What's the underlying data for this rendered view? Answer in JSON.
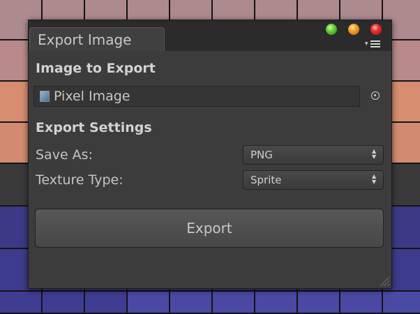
{
  "background": {
    "rows": [
      [
        "#ac8a85",
        "#ac8a85",
        "#d6be75",
        "#ac8a85",
        "#ac8a85",
        "#ac8a85",
        "#ac8a85",
        "#d6be75",
        "#ac8a85",
        "#ac8a85"
      ],
      [
        "#ac8a8e",
        "#ac8a8e",
        "#ac8a8e",
        "#ac8a8e",
        "#ac8a8e",
        "#ac8a8e",
        "#ac8a8e",
        "#ac8a8e",
        "#ac8a8e",
        "#ac8a8e"
      ],
      [
        "#b88a8a",
        "#b88a8a",
        "#b88a8a",
        "#b88a8a",
        "#b88a8a",
        "#b88a8a",
        "#b88a8a",
        "#b88a8a",
        "#b88a8a",
        "#b88a8a"
      ],
      [
        "#d68d70",
        "#d68d70",
        "#d68d70",
        "#d68d70",
        "#d68d70",
        "#d68d70",
        "#d68d70",
        "#d68d70",
        "#d68d70",
        "#d68d70"
      ],
      [
        "#d28a70",
        "#d28a70",
        "#d28a70",
        "#d28a70",
        "#d28a70",
        "#d28a70",
        "#d28a70",
        "#d28a70",
        "#d28a70",
        "#d28a70"
      ],
      [
        "#3a3a3a",
        "#3a3a3a",
        "#3a3a3a",
        "#3a3a3a",
        "#3a3a3a",
        "#3a3a3a",
        "#3a3a3a",
        "#3a3a3a",
        "#3a3a3a",
        "#3a3a3a"
      ],
      [
        "#3c3a86",
        "#3c3a86",
        "#3c3a86",
        "#3c3a86",
        "#3c3a86",
        "#3c3a86",
        "#3c3a86",
        "#3c3a86",
        "#3c3a86",
        "#3c3a86"
      ],
      [
        "#3d3b8c",
        "#3d3b8c",
        "#3d3b8c",
        "#3d3b8c",
        "#3d3b8c",
        "#3d3b8c",
        "#3d3b8c",
        "#3d3b8c",
        "#3d3b8c",
        "#3d3b8c"
      ],
      [
        "#3f3d92",
        "#3f3d92",
        "#3f3d92",
        "#4a49a4",
        "#4a49a4",
        "#4a49a4",
        "#4a49a4",
        "#4a49a4",
        "#4a49a4",
        "#4a49a4"
      ]
    ]
  },
  "window": {
    "tab_title": "Export Image",
    "controls": [
      "green-button",
      "orange-button",
      "red-button"
    ],
    "menu_icon": "dropdown-menu-icon"
  },
  "image_section": {
    "title": "Image to Export",
    "object_field": {
      "value": "Pixel Image",
      "icon": "image-asset-icon",
      "picker_icon": "object-picker-icon"
    }
  },
  "settings_section": {
    "title": "Export Settings",
    "save_as": {
      "label": "Save As:",
      "value": "PNG"
    },
    "texture_type": {
      "label": "Texture Type:",
      "value": "Sprite"
    }
  },
  "export_button": {
    "label": "Export"
  },
  "colors": {
    "window_bg": "#3c3c3c",
    "tabbar_bg": "#2b2b2b",
    "text": "#c8c8c8"
  }
}
